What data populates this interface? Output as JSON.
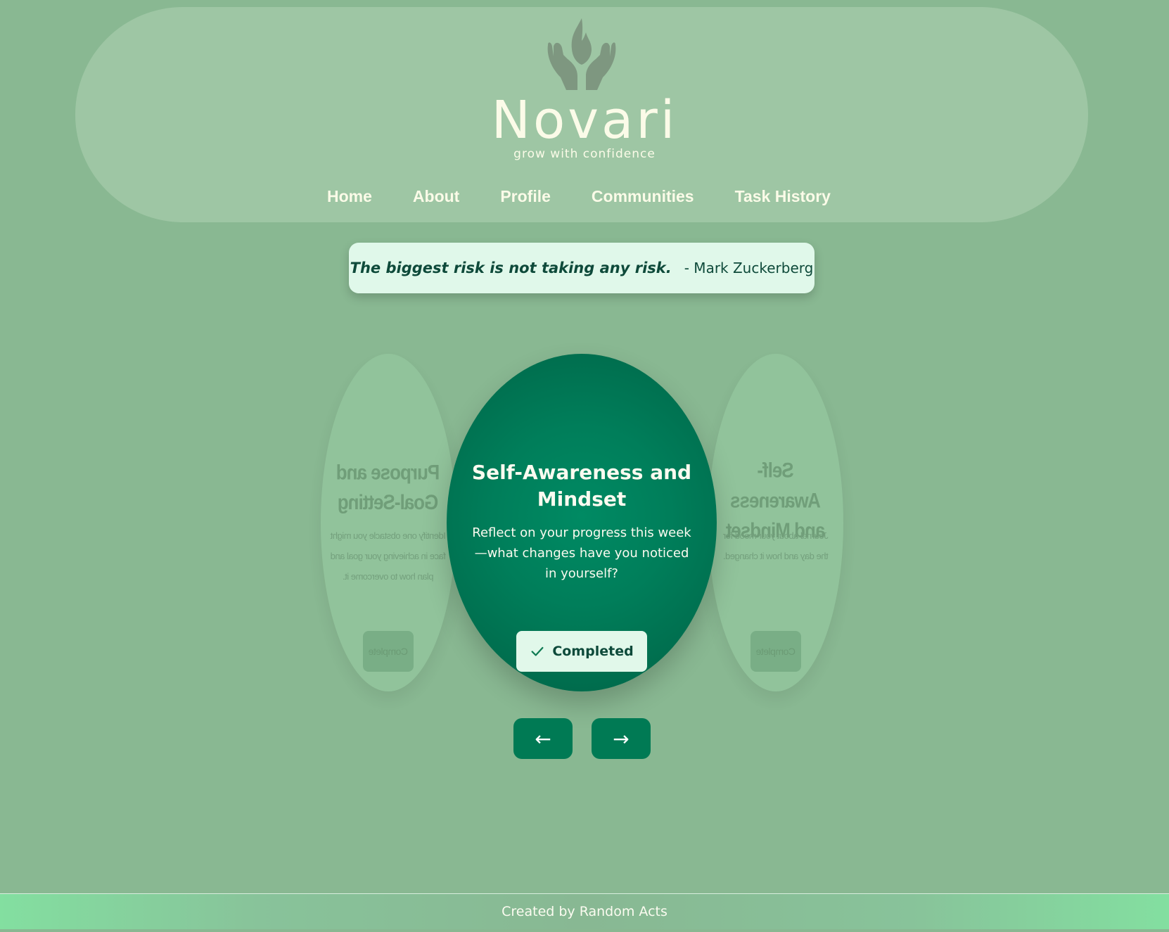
{
  "brand": {
    "name": "Novari",
    "tagline": "grow with confidence"
  },
  "nav": {
    "home": "Home",
    "about": "About",
    "profile": "Profile",
    "communities": "Communities",
    "task_history": "Task History"
  },
  "quote": {
    "text": "The biggest risk is not taking any risk.",
    "author": "- Mark Zuckerberg"
  },
  "carousel": {
    "left_card": {
      "title": "Purpose and Goal-Setting",
      "description": "Identify one obstacle you might face in achieving your goal and plan how to overcome it.",
      "button": "Complete"
    },
    "active_card": {
      "title": "Self-Awareness and Mindset",
      "description": "Reflect on your progress this week—what changes have you noticed in yourself?",
      "button": "Completed"
    },
    "right_card": {
      "title": "Self-Awareness and Mindset",
      "description": "Journal about your mood for the day and how it changed.",
      "button": "Complete"
    },
    "prev_label": "←",
    "next_label": "→"
  },
  "footer": {
    "text": "Created by Random Acts"
  },
  "colors": {
    "background": "#89b892",
    "header": "#9ec6a4",
    "accent": "#007a54",
    "text_light": "#fbfbe8"
  }
}
